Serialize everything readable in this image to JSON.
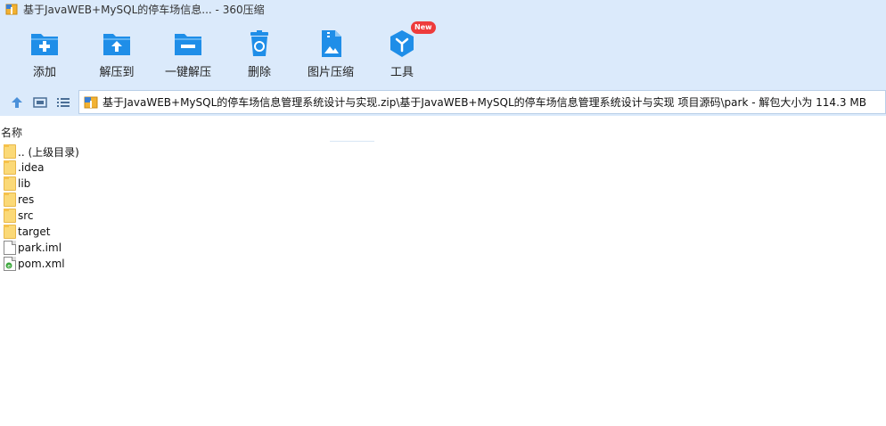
{
  "window": {
    "title": "基于JavaWEB+MySQL的停车场信息... - 360压缩"
  },
  "toolbar": {
    "add_label": "添加",
    "extract_to_label": "解压到",
    "one_click_extract_label": "一键解压",
    "delete_label": "删除",
    "image_compress_label": "图片压缩",
    "tools_label": "工具",
    "tools_badge": "New"
  },
  "address_bar": {
    "path": "基于JavaWEB+MySQL的停车场信息管理系统设计与实现.zip\\基于JavaWEB+MySQL的停车场信息管理系统设计与实现 项目源码\\park - 解包大小为 114.3 MB"
  },
  "file_list": {
    "column_name": "名称",
    "items": [
      {
        "name": ".. (上级目录)",
        "icon": "folder-icon"
      },
      {
        "name": ".idea",
        "icon": "folder-icon"
      },
      {
        "name": "lib",
        "icon": "folder-icon"
      },
      {
        "name": "res",
        "icon": "folder-icon"
      },
      {
        "name": "src",
        "icon": "folder-icon"
      },
      {
        "name": "target",
        "icon": "folder-icon"
      },
      {
        "name": "park.iml",
        "icon": "file-icon"
      },
      {
        "name": "pom.xml",
        "icon": "xml-file-icon"
      }
    ]
  },
  "colors": {
    "toolbar_bg": "#dbeafb",
    "icon_blue": "#1f8ee8",
    "badge_red": "#ee3b3b"
  }
}
